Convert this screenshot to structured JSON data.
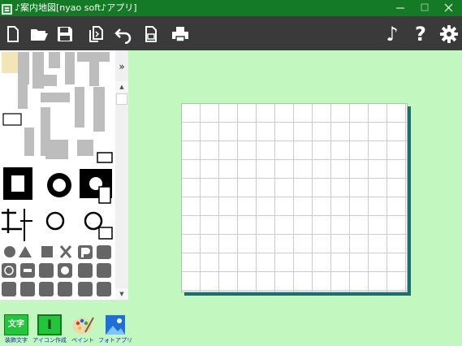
{
  "window": {
    "title": "♪案内地図[nyao soft♪アプリ]",
    "minimize_glyph": "─",
    "maximize_glyph": "☐",
    "close_glyph": "✕"
  },
  "toolbar": {
    "icons": [
      "new-file-icon",
      "open-folder-icon",
      "save-icon",
      "copy-icon",
      "undo-icon",
      "export-icon",
      "print-icon",
      "music-icon",
      "help-icon",
      "gear-icon"
    ],
    "help_glyph": "?",
    "music_glyph": "♪"
  },
  "palette": {
    "expand_glyph": "»",
    "scroll_up_glyph": "▲",
    "scroll_down_glyph": "▼"
  },
  "bottom_buttons": [
    {
      "icon_text": "文字",
      "label": "装飾文字"
    },
    {
      "icon_text": "I",
      "label": "アイコン作成"
    },
    {
      "icon_text": "",
      "label": "ペイント"
    },
    {
      "icon_text": "",
      "label": "フォトアプリ"
    }
  ],
  "colors": {
    "titlebar": "#157a26",
    "toolbar": "#3a3a3a",
    "workspace": "#c2f7c0",
    "canvas_shadow": "#1a6f70",
    "label": "#1a2aa0"
  }
}
